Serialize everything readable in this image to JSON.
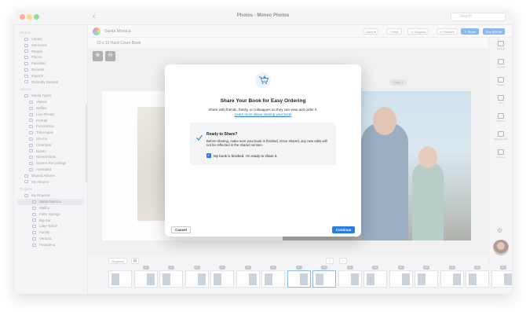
{
  "window": {
    "title": "Photos - Mimeo Photos",
    "search_placeholder": "Search"
  },
  "sidebar": {
    "sections": [
      {
        "label": "Photos",
        "items": [
          "Library",
          "Memories",
          "People",
          "Places",
          "Favorites",
          "Recents",
          "Imports",
          "Recently Deleted"
        ]
      },
      {
        "label": "Albums",
        "items": [
          "Media Types",
          "Videos",
          "Selfies",
          "Live Photos",
          "Portrait",
          "Panoramas",
          "Time-lapse",
          "Slo-mo",
          "Cinematic",
          "Bursts",
          "Screenshots",
          "Screen Recordings",
          "Animated",
          "Shared Albums",
          "My Albums"
        ]
      },
      {
        "label": "Projects",
        "items": [
          "My Projects",
          "Santa Monica",
          "Malibu",
          "Palm Springs",
          "Big Sur",
          "Lake Tahoe",
          "Family",
          "Ventura",
          "Pasadena"
        ]
      }
    ],
    "selected": "Santa Monica"
  },
  "toolbar": {
    "project_name": "Santa Monica",
    "book_type": "13 x 10 Hard Cover Book",
    "buttons": {
      "save": "Save",
      "help": "Help",
      "support": "Support",
      "preview": "Preview",
      "share": "Share",
      "buy": "Buy $35.99"
    }
  },
  "canvas": {
    "page_label": "Page 1"
  },
  "right_panel": {
    "items": [
      "Settings",
      "Layouts",
      "Photos",
      "Text",
      "Stickers",
      "Backgrounds",
      "Arrange"
    ]
  },
  "strip": {
    "organize_label": "Organize"
  },
  "filmstrip": {
    "page_numbers": [
      "1",
      "2",
      "3",
      "4",
      "5",
      "6",
      "7",
      "8",
      "9",
      "10",
      "11",
      "12",
      "13",
      "14",
      "15"
    ]
  },
  "modal": {
    "title": "Share Your Book for Easy Ordering",
    "description": "Share with friends, family, or colleagues so they can view and order it.",
    "link": "Learn more about sharing your book",
    "ready_title": "Ready to Share?",
    "ready_description": "Before sharing, make sure your book is finished. Once shared, any new edits will not be reflected in the shared version.",
    "checkbox_label": "My book is finished. I'm ready to share it.",
    "checkbox_checked": true,
    "cancel": "Cancel",
    "continue": "Continue"
  },
  "colors": {
    "accent": "#2a7de1"
  }
}
